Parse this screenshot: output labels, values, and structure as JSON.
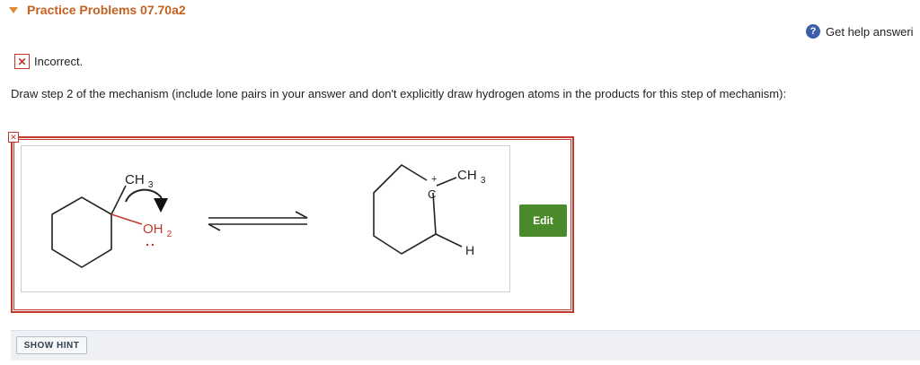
{
  "header": {
    "title": "Practice Problems 07.70a2"
  },
  "help": {
    "icon_text": "?",
    "label": "Get help answeri"
  },
  "result": {
    "icon": "✕",
    "status": "Incorrect."
  },
  "question": {
    "instructions": "Draw step 2 of the mechanism (include lone pairs in your answer and don't explicitly draw hydrogen atoms in the products for this step of mechanism):"
  },
  "answer_box": {
    "error_icon": "✕",
    "reactant": {
      "methyl_label": "CH3",
      "leaving_group_label": "OH2"
    },
    "product": {
      "carbocation_label": "C",
      "charge": "+",
      "methyl_label": "CH3",
      "hydrogen_label": "H"
    },
    "arrow": "equilibrium"
  },
  "edit_button": {
    "label": "Edit"
  },
  "hint_button": {
    "label": "SHOW HINT"
  },
  "colors": {
    "accent_orange": "#c3611f",
    "error_red": "#c0392b",
    "edit_green": "#4a8a2a",
    "help_blue": "#3b5ea8"
  }
}
